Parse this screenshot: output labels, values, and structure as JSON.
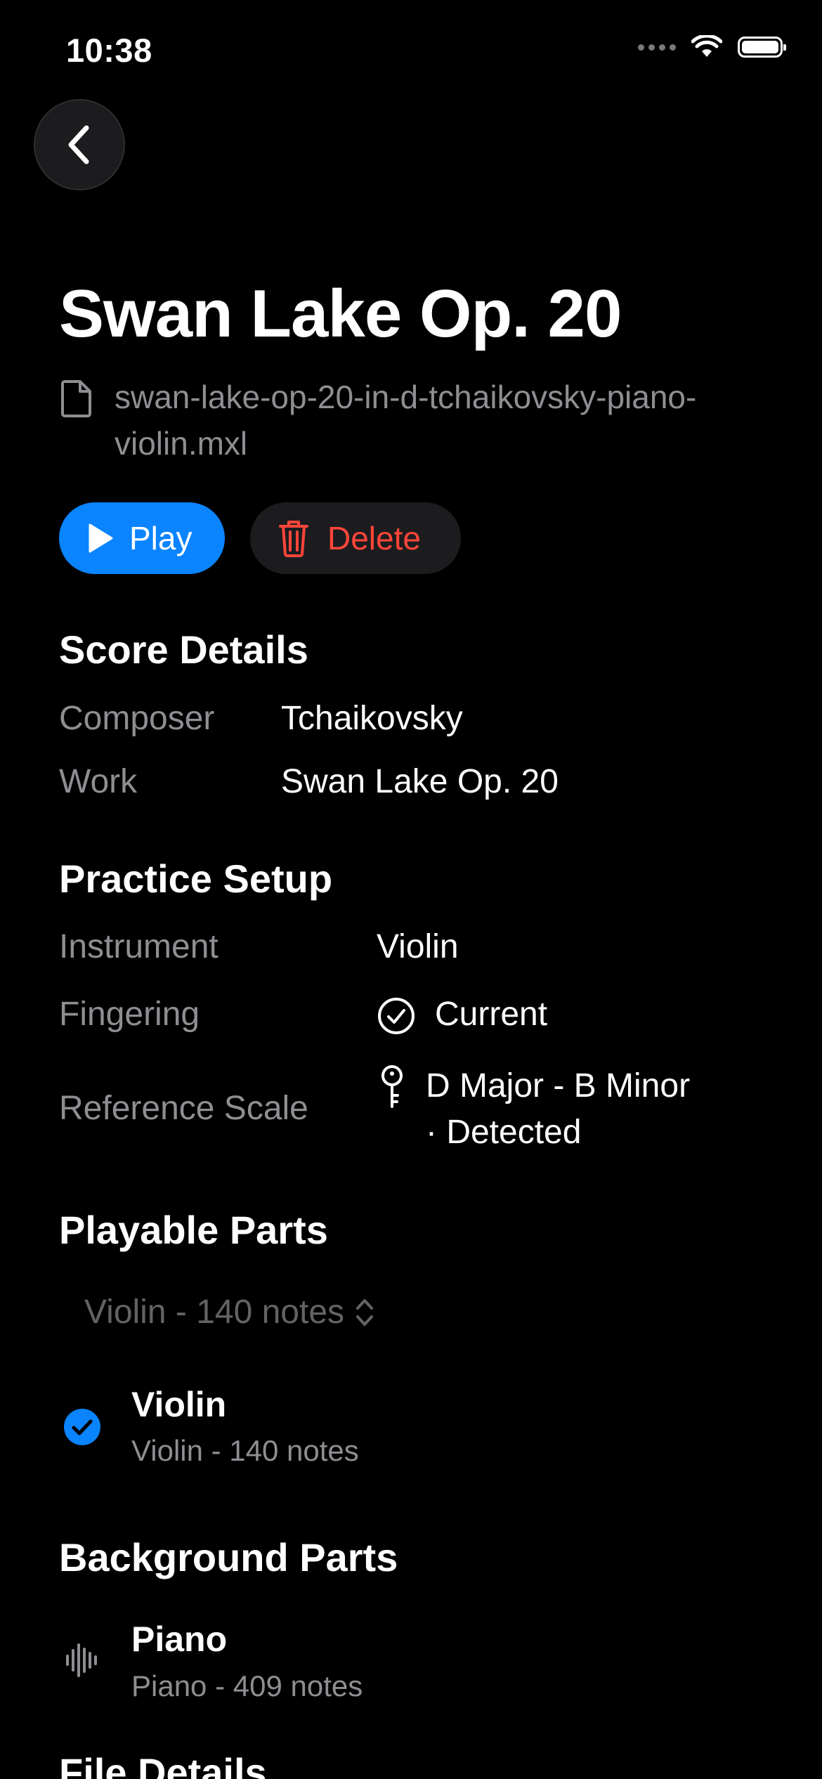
{
  "status_bar": {
    "time": "10:38"
  },
  "header": {
    "back_icon": "chevron-left-icon"
  },
  "score": {
    "title": "Swan Lake Op. 20",
    "filename": "swan-lake-op-20-in-d-tchaikovsky-piano-violin.mxl",
    "file_icon": "document-icon"
  },
  "actions": {
    "play_label": "Play",
    "delete_label": "Delete",
    "play_color": "#0a84ff",
    "delete_color": "#ff453a"
  },
  "score_details": {
    "title": "Score Details",
    "rows": [
      {
        "label": "Composer",
        "value": "Tchaikovsky"
      },
      {
        "label": "Work",
        "value": "Swan Lake Op. 20"
      }
    ]
  },
  "practice_setup": {
    "title": "Practice Setup",
    "instrument_label": "Instrument",
    "instrument_value": "Violin",
    "fingering_label": "Fingering",
    "fingering_value": "Current",
    "scale_label": "Reference Scale",
    "scale_value_line1": "D Major - B Minor",
    "scale_value_line2": "· Detected"
  },
  "playable_parts": {
    "title": "Playable Parts",
    "picker_value": "Violin - 140 notes",
    "items": [
      {
        "name": "Violin",
        "detail": "Violin - 140 notes",
        "selected": true
      }
    ]
  },
  "background_parts": {
    "title": "Background Parts",
    "items": [
      {
        "name": "Piano",
        "detail": "Piano - 409 notes",
        "icon": "waveform-icon"
      }
    ]
  },
  "file_details": {
    "title": "File Details"
  }
}
